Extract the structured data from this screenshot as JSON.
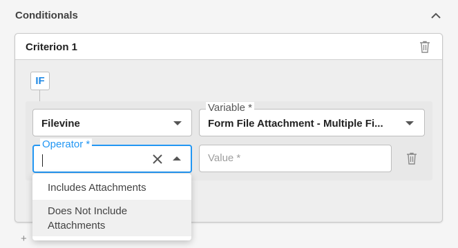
{
  "section": {
    "title": "Conditionals",
    "collapse_icon": "chevron-up-icon"
  },
  "criterion": {
    "title": "Criterion 1",
    "delete_icon": "trash-icon",
    "if_label": "IF"
  },
  "row1": {
    "source": {
      "value": "Filevine"
    },
    "variable": {
      "label": "Variable *",
      "value": "Form File Attachment - Multiple Fi..."
    }
  },
  "row2": {
    "operator": {
      "label": "Operator *",
      "value": ""
    },
    "value_field": {
      "placeholder": "Value *"
    }
  },
  "operator_options": [
    {
      "label": "Includes Attachments"
    },
    {
      "label_line1": "Does Not Include",
      "label_line2": "Attachments"
    }
  ],
  "add_control": {
    "symbol": "+"
  },
  "colors": {
    "accent": "#2196f3",
    "if_badge_text": "#1e88e5"
  }
}
